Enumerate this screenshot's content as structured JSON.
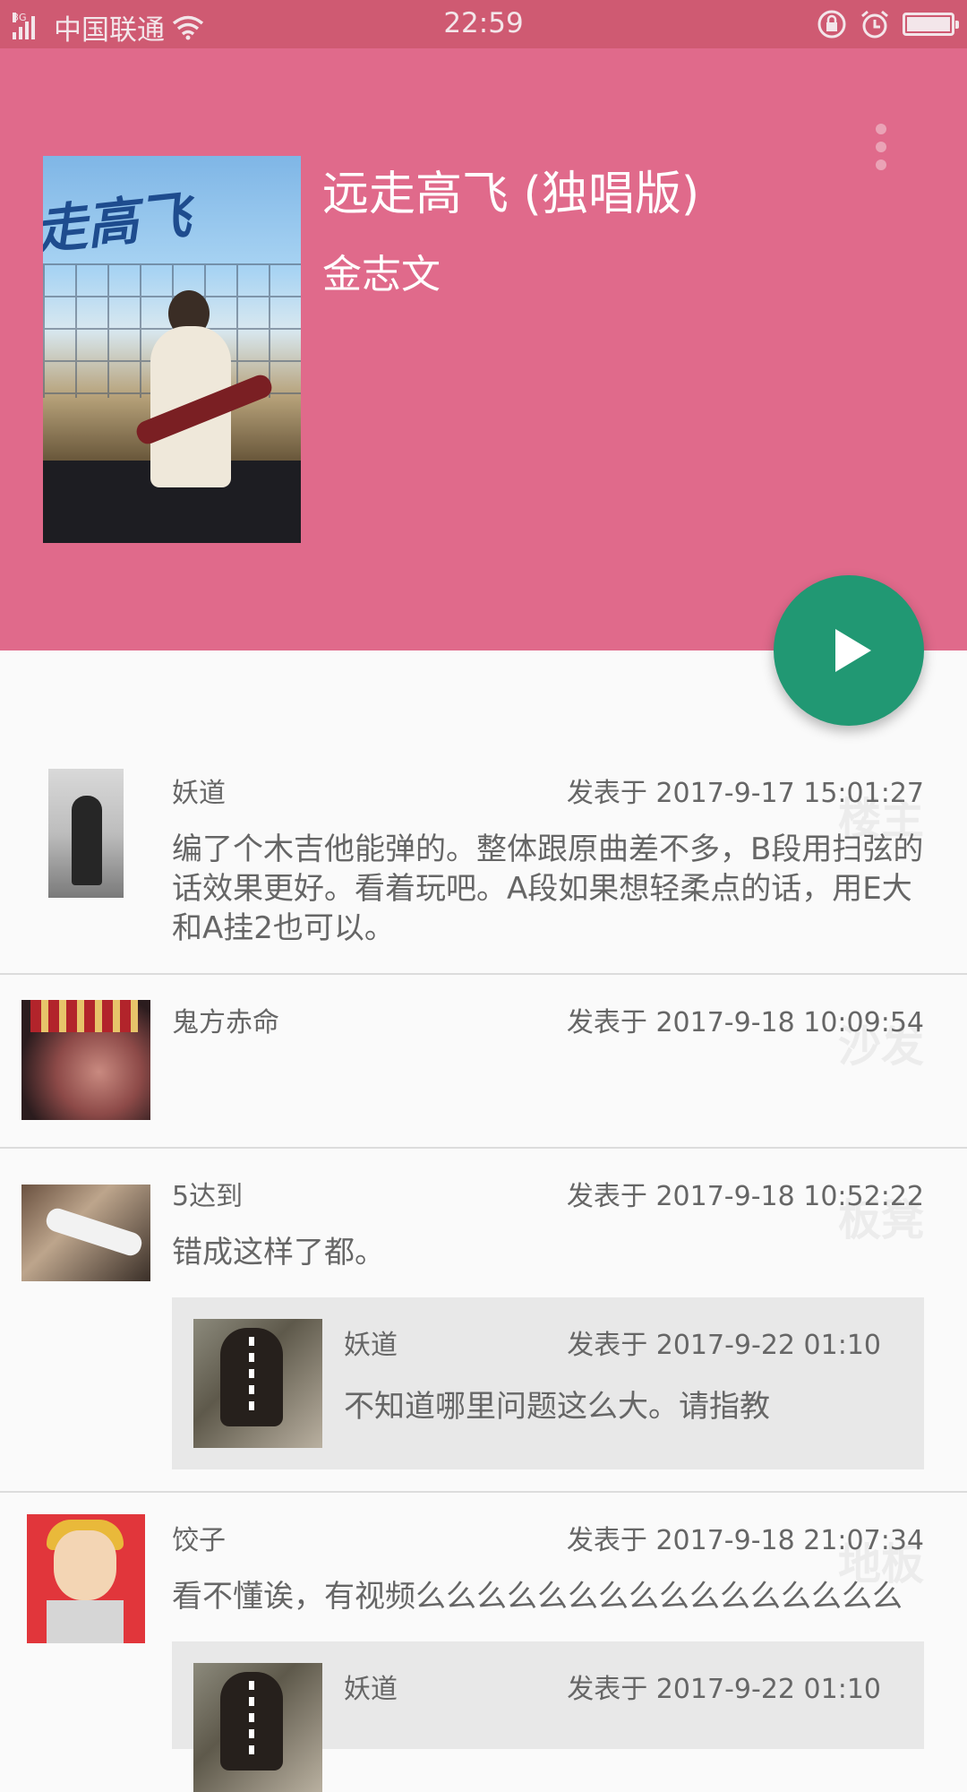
{
  "status_bar": {
    "network_type": "3G",
    "carrier": "中国联通",
    "time": "22:59",
    "icons": [
      "signal-icon",
      "wifi-icon",
      "lock-rotation-icon",
      "alarm-icon",
      "battery-icon"
    ]
  },
  "song": {
    "title": "远走高飞 (独唱版)",
    "artist": "金志文",
    "header_color": "#e06a8b",
    "fab_color": "#219873"
  },
  "comments": [
    {
      "user": "妖道",
      "time": "发表于 2017-9-17 15:01:27",
      "floor": "楼主",
      "text": "编了个木吉他能弹的。整体跟原曲差不多，B段用扫弦的话效果更好。看着玩吧。A段如果想轻柔点的话，用E大和A挂2也可以。",
      "replies": []
    },
    {
      "user": "鬼方赤命",
      "time": "发表于 2017-9-18 10:09:54",
      "floor": "沙发",
      "text": "",
      "replies": []
    },
    {
      "user": "5达到",
      "time": "发表于 2017-9-18 10:52:22",
      "floor": "板凳",
      "text": "错成这样了都。",
      "replies": [
        {
          "user": "妖道",
          "time": "发表于 2017-9-22 01:10",
          "text": "不知道哪里问题这么大。请指教"
        }
      ]
    },
    {
      "user": "饺子",
      "time": "发表于 2017-9-18 21:07:34",
      "floor": "地板",
      "text": "看不懂诶，有视频么么么么么么么么么么么么么么么么",
      "replies": [
        {
          "user": "妖道",
          "time": "发表于 2017-9-22 01:10",
          "text": ""
        }
      ]
    }
  ]
}
